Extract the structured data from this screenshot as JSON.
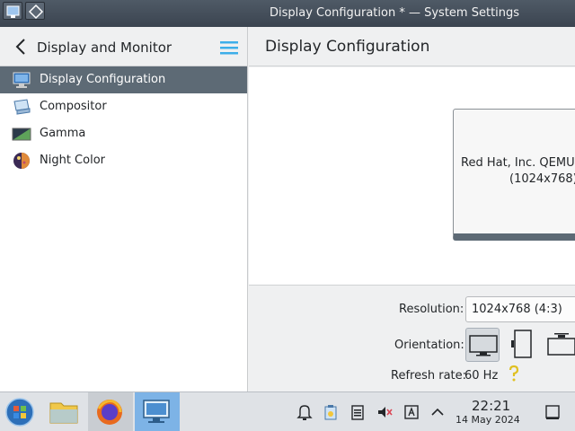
{
  "window": {
    "title": "Display Configuration * — System Settings"
  },
  "sidebar": {
    "title": "Display and Monitor",
    "items": [
      {
        "label": "Display Configuration",
        "icon": "display-icon",
        "selected": true
      },
      {
        "label": "Compositor",
        "icon": "compositor-icon",
        "selected": false
      },
      {
        "label": "Gamma",
        "icon": "gamma-icon",
        "selected": false
      },
      {
        "label": "Night Color",
        "icon": "night-color-icon",
        "selected": false
      }
    ]
  },
  "main": {
    "title": "Display Configuration",
    "monitor": {
      "name": "Red Hat, Inc. QEMU M",
      "resolution": "(1024x768)"
    },
    "settings": {
      "resolution_label": "Resolution:",
      "resolution_value": "1024x768 (4:3)",
      "orientation_label": "Orientation:",
      "refresh_label": "Refresh rate:",
      "refresh_value": "60 Hz"
    }
  },
  "taskbar": {
    "apps": [
      {
        "icon": "start-menu-icon"
      },
      {
        "icon": "file-manager-icon"
      },
      {
        "icon": "firefox-icon"
      },
      {
        "icon": "system-settings-icon"
      }
    ],
    "tray": [
      "notifications-icon",
      "clipboard-icon",
      "notes-icon",
      "volume-muted-icon",
      "keyboard-layout-icon",
      "expand-tray-icon",
      "show-desktop-icon"
    ],
    "clock": {
      "time": "22:21",
      "date": "14 May 2024"
    }
  },
  "colors": {
    "accent": "#5d6a75",
    "active_task": "#7db3e6",
    "titlebar": "#3b4450"
  }
}
